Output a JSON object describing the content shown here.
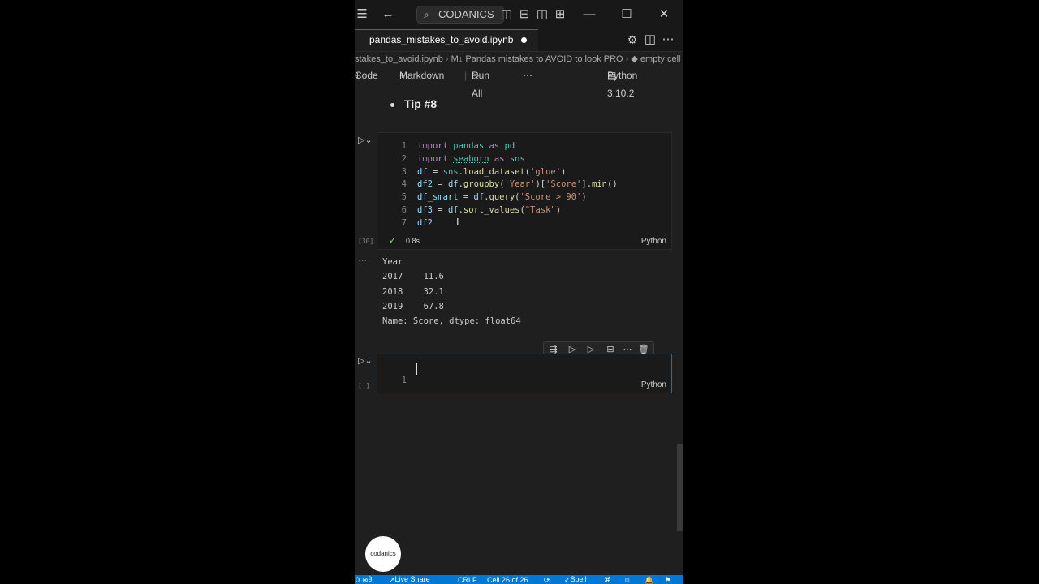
{
  "titlebar": {
    "search_label": "CODANICS"
  },
  "tab": {
    "filename": "pandas_mistakes_to_avoid.ipynb"
  },
  "breadcrumb": {
    "file": "stakes_to_avoid.ipynb",
    "heading": "Pandas mistakes to AVOID to look PRO",
    "cell": "empty cell"
  },
  "toolbar": {
    "code": "Code",
    "markdown": "Markdown",
    "run_all": "Run All",
    "kernel": "Python 3.10.2"
  },
  "tip": "Tip #8",
  "cell1": {
    "exec_count": "[30]",
    "time": "0.8s",
    "lang": "Python",
    "line_numbers": [
      "1",
      "2",
      "3",
      "4",
      "5",
      "6",
      "7"
    ],
    "lines": [
      [
        {
          "t": "import",
          "c": "kw"
        },
        {
          "t": " ",
          "c": "pl"
        },
        {
          "t": "pandas",
          "c": "mod"
        },
        {
          "t": " as ",
          "c": "kw"
        },
        {
          "t": "pd",
          "c": "mod"
        }
      ],
      [
        {
          "t": "import",
          "c": "kw"
        },
        {
          "t": " ",
          "c": "pl"
        },
        {
          "t": "seaborn",
          "c": "mod"
        },
        {
          "t": " as ",
          "c": "kw"
        },
        {
          "t": "sns",
          "c": "mod"
        }
      ],
      [
        {
          "t": "df",
          "c": "var"
        },
        {
          "t": " = ",
          "c": "pl"
        },
        {
          "t": "sns",
          "c": "mod"
        },
        {
          "t": ".",
          "c": "pl"
        },
        {
          "t": "load_dataset",
          "c": "fn"
        },
        {
          "t": "(",
          "c": "pl"
        },
        {
          "t": "'glue'",
          "c": "str"
        },
        {
          "t": ")",
          "c": "pl"
        }
      ],
      [
        {
          "t": "df2",
          "c": "var"
        },
        {
          "t": " = ",
          "c": "pl"
        },
        {
          "t": "df",
          "c": "var"
        },
        {
          "t": ".",
          "c": "pl"
        },
        {
          "t": "groupby",
          "c": "fn"
        },
        {
          "t": "(",
          "c": "pl"
        },
        {
          "t": "'Year'",
          "c": "str"
        },
        {
          "t": ")[",
          "c": "pl"
        },
        {
          "t": "'Score'",
          "c": "str"
        },
        {
          "t": "].",
          "c": "pl"
        },
        {
          "t": "min",
          "c": "fn"
        },
        {
          "t": "()",
          "c": "pl"
        }
      ],
      [
        {
          "t": "df_smart",
          "c": "var"
        },
        {
          "t": " = ",
          "c": "pl"
        },
        {
          "t": "df",
          "c": "var"
        },
        {
          "t": ".",
          "c": "pl"
        },
        {
          "t": "query",
          "c": "fn"
        },
        {
          "t": "(",
          "c": "pl"
        },
        {
          "t": "'Score > 90'",
          "c": "str"
        },
        {
          "t": ")",
          "c": "pl"
        }
      ],
      [
        {
          "t": "df3",
          "c": "var"
        },
        {
          "t": " = ",
          "c": "pl"
        },
        {
          "t": "df",
          "c": "var"
        },
        {
          "t": ".",
          "c": "pl"
        },
        {
          "t": "sort_values",
          "c": "fn"
        },
        {
          "t": "(",
          "c": "pl"
        },
        {
          "t": "\"Task\"",
          "c": "str"
        },
        {
          "t": ")",
          "c": "pl"
        }
      ],
      [
        {
          "t": "df2",
          "c": "var"
        }
      ]
    ]
  },
  "output": {
    "lines": [
      "Year",
      "2017    11.6",
      "2018    32.1",
      "2019    67.8",
      "Name: Score, dtype: float64"
    ]
  },
  "cell2": {
    "exec_count": "[ ]",
    "line_number": "1",
    "lang": "Python"
  },
  "avatar_text": "codanics",
  "status": {
    "remote": "0",
    "problems": "9",
    "live_share": "Live Share",
    "eol": "CRLF",
    "cell_pos": "Cell 26 of 26",
    "spell": "Spell"
  },
  "colors": {
    "accent": "#0078d4",
    "editor_bg": "#1f1f1f",
    "titlebar_bg": "#181818"
  }
}
